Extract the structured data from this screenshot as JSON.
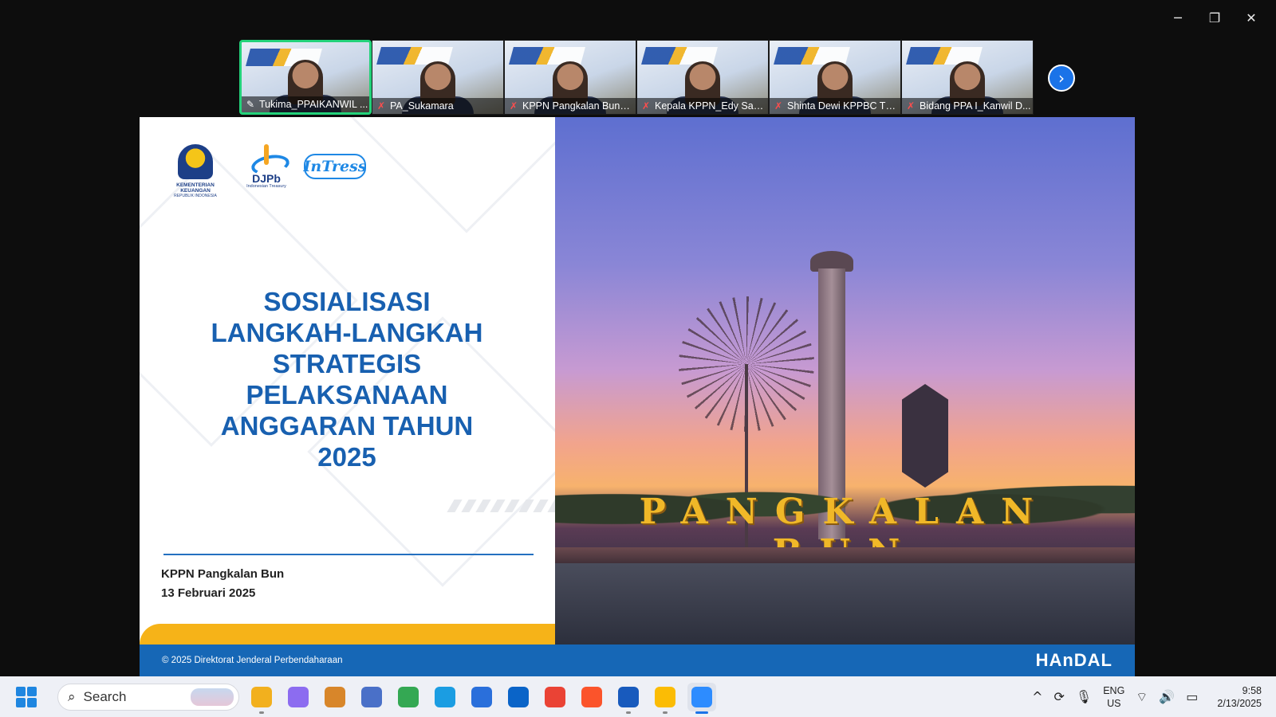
{
  "window": {
    "controls": {
      "minimize": "─",
      "restore": "❐",
      "close": "✕"
    }
  },
  "participants": [
    {
      "name": "Tukima_PPAIKANWIL ...",
      "active": true,
      "icon": "pin-icon"
    },
    {
      "name": "PA_Sukamara",
      "active": false,
      "icon": "mic-muted-icon"
    },
    {
      "name": "KPPN Pangkalan Bun_I...",
      "active": false,
      "icon": "mic-muted-icon"
    },
    {
      "name": "Kepala KPPN_Edy Sant...",
      "active": false,
      "icon": "mic-muted-icon"
    },
    {
      "name": "Shinta Dewi KPPBC TM...",
      "active": false,
      "icon": "mic-muted-icon"
    },
    {
      "name": "Bidang PPA I_Kanwil D...",
      "active": false,
      "icon": "mic-muted-icon"
    }
  ],
  "next_button_glyph": "›",
  "slide": {
    "logos": {
      "kemenkeu_line1": "KEMENTERIAN KEUANGAN",
      "kemenkeu_line2": "REPUBLIK INDONESIA",
      "djpb_line1": "DJPb",
      "djpb_line2": "Indonesian Treasury",
      "intress": "InTress"
    },
    "title_lines": [
      "SOSIALISASI",
      "LANGKAH-LANGKAH",
      "STRATEGIS",
      "PELAKSANAAN",
      "ANGGARAN TAHUN",
      "2025"
    ],
    "org": "KPPN Pangkalan Bun",
    "date": "13 Februari 2025",
    "photo_sign": "PANGKALAN BUN",
    "footer": "© 2025 Direktorat Jenderal Perbendaharaan",
    "footer_logo": "HAnDAL"
  },
  "taskbar": {
    "search_placeholder": "Search",
    "apps": [
      {
        "name": "file-explorer",
        "color": "#f2b01e",
        "active": false,
        "running": true
      },
      {
        "name": "copilot",
        "color": "#8c6cf0",
        "active": false,
        "running": false
      },
      {
        "name": "app-3",
        "color": "#d8862a",
        "active": false,
        "running": false
      },
      {
        "name": "app-4",
        "color": "#4a70c8",
        "active": false,
        "running": false
      },
      {
        "name": "chrome",
        "color": "#34a853",
        "active": false,
        "running": false
      },
      {
        "name": "edge",
        "color": "#1b9de2",
        "active": false,
        "running": false
      },
      {
        "name": "microsoft-store",
        "color": "#2a6fdb",
        "active": false,
        "running": false
      },
      {
        "name": "outlook",
        "color": "#0a64c8",
        "active": false,
        "running": false
      },
      {
        "name": "chrome-profile",
        "color": "#ea4335",
        "active": false,
        "running": false
      },
      {
        "name": "brave",
        "color": "#fb542b",
        "active": false,
        "running": false
      },
      {
        "name": "word",
        "color": "#185abd",
        "active": false,
        "running": true
      },
      {
        "name": "chrome-2",
        "color": "#fbbc05",
        "active": false,
        "running": true
      },
      {
        "name": "zoom",
        "color": "#2d8cff",
        "active": true,
        "running": true
      }
    ],
    "tray": {
      "chevron": "^",
      "sync": "⟳",
      "mic": "🎙",
      "lang_line1": "ENG",
      "lang_line2": "US",
      "wifi": "⌔",
      "volume": "🔊",
      "battery": "▭",
      "time": "9:58",
      "date": "2/13/2025"
    }
  }
}
